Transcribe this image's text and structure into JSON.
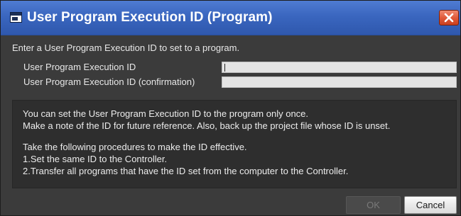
{
  "window": {
    "title": "User Program Execution ID (Program)",
    "icon": "dialog-window-icon",
    "close_icon": "close-x-icon"
  },
  "form": {
    "prompt": "Enter a User Program Execution ID to set to a program.",
    "id_label": "User Program Execution ID",
    "id_value": "",
    "confirm_label": "User Program Execution ID (confirmation)",
    "confirm_value": ""
  },
  "info": {
    "lines": [
      "You can set the User Program Execution ID to the program only once.",
      "Make a note of the ID for future reference. Also, back up the project file whose ID is unset.",
      "Take the following procedures to make the ID effective.",
      "1.Set the same ID to the Controller.",
      "2.Transfer all programs that have the ID set from the computer to the Controller."
    ]
  },
  "buttons": {
    "ok_label": "OK",
    "ok_enabled": false,
    "cancel_label": "Cancel"
  },
  "colors": {
    "titlebar": "#3a66bf",
    "background": "#3b3b3b",
    "info_box": "#2e2e2e",
    "close_button": "#df5636"
  }
}
